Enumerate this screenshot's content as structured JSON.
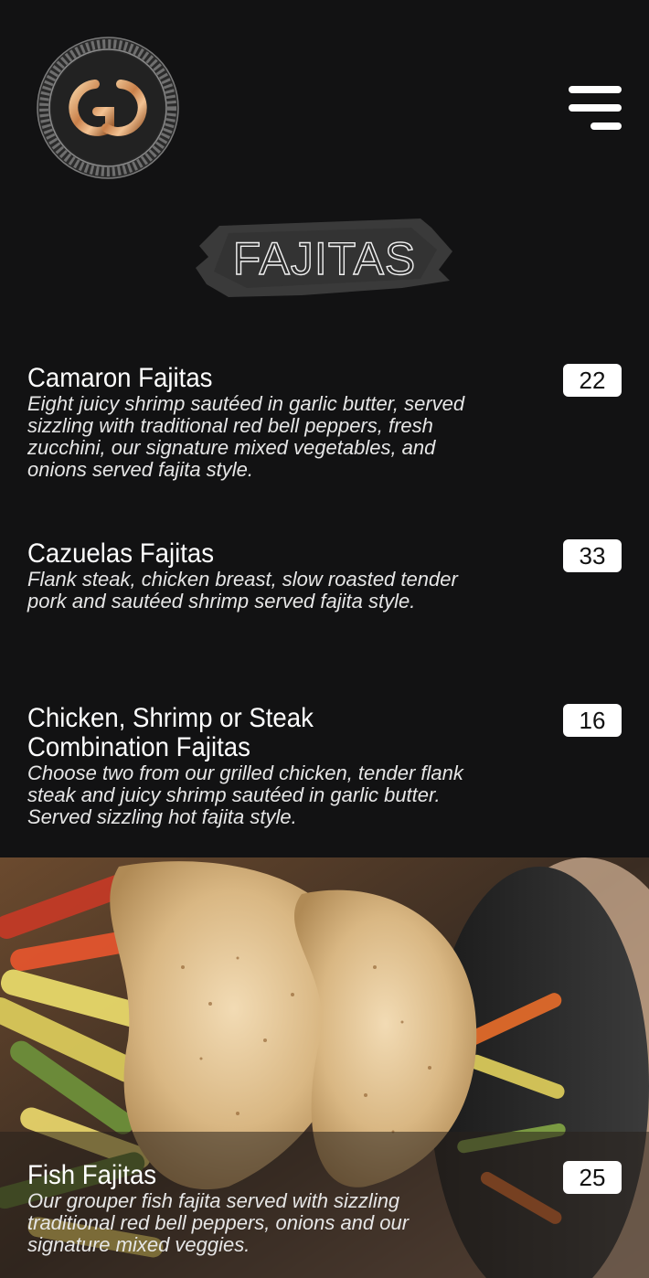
{
  "header": {
    "logo_icon": "gg-emblem-logo",
    "menu_icon": "hamburger-menu-icon"
  },
  "section": {
    "title": "FAJITAS"
  },
  "items": [
    {
      "name": "Camaron Fajitas",
      "description": "Eight juicy shrimp sautéed in garlic butter, served sizzling with traditional red bell peppers, fresh zucchini, our signature mixed vegetables, and onions served fajita style.",
      "price": "22"
    },
    {
      "name": "Cazuelas Fajitas",
      "description": "Flank steak, chicken breast, slow roasted tender pork and sautéed shrimp served fajita style.",
      "price": "33"
    },
    {
      "name": "Chicken, Shrimp or Steak Combination Fajitas",
      "description": "Choose two from our grilled chicken, tender flank steak and juicy shrimp sautéed in garlic butter. Served sizzling hot fajita style.",
      "price": "16"
    },
    {
      "name": "Fish Fajitas",
      "description": "Our grouper fish fajita served with sizzling traditional red bell peppers, onions and our signature mixed veggies.",
      "price": "25"
    }
  ],
  "colors": {
    "background": "#121213",
    "text": "#ffffff",
    "price_badge": "#ffffff",
    "logo_gold": "#d99a5c"
  }
}
